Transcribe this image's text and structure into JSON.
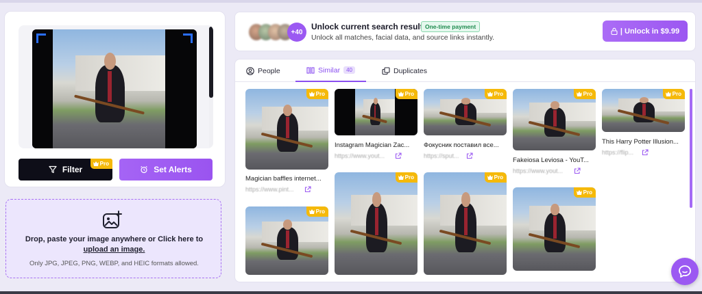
{
  "left_panel": {
    "filter_label": "Filter",
    "filter_pro_label": "Pro",
    "alerts_label": "Set Alerts",
    "upload": {
      "text_prefix": "Drop, paste your image anywhere or Click here to ",
      "link": "upload an image.",
      "formats_note": "Only JPG, JPEG, PNG, WEBP, and HEIC formats allowed."
    }
  },
  "unlock_banner": {
    "avatar_count": "+40",
    "title": "Unlock current search results",
    "badge": "One-time payment",
    "subtitle": "Unlock all matches, facial data, and source links instantly.",
    "button_label": "| Unlock in $9.99"
  },
  "tabs": [
    {
      "label": "People",
      "icon": "user-circle-icon",
      "active": false
    },
    {
      "label": "Similar",
      "icon": "compare-icon",
      "active": true,
      "count": "40"
    },
    {
      "label": "Duplicates",
      "icon": "copy-icon",
      "active": false
    }
  ],
  "pro_label": "Pro",
  "results": [
    {
      "title": "Magician baffles internet...",
      "link": "https://www.pint..."
    },
    {
      "title": "Instagram Magician Zac...",
      "link": "https://www.yout..."
    },
    {
      "title": "Фокусник поставил все...",
      "link": "https://sput..."
    },
    {
      "title": "Fakeiosa Leviosa - YouT...",
      "link": "https://www.yout..."
    },
    {
      "title": "This Harry Potter Illusion...",
      "link": "https://flip..."
    }
  ],
  "colors": {
    "accent": "#9b59f2",
    "pro_badge": "#f5b90a",
    "dark_button": "#0e0e18"
  },
  "icons": {
    "chat": "chat-bubble-icon",
    "filter": "filter-icon",
    "alerts": "bell-icon",
    "lock": "lock-icon",
    "upload": "image-add-icon",
    "external": "external-link-icon",
    "crown": "crown-icon"
  }
}
